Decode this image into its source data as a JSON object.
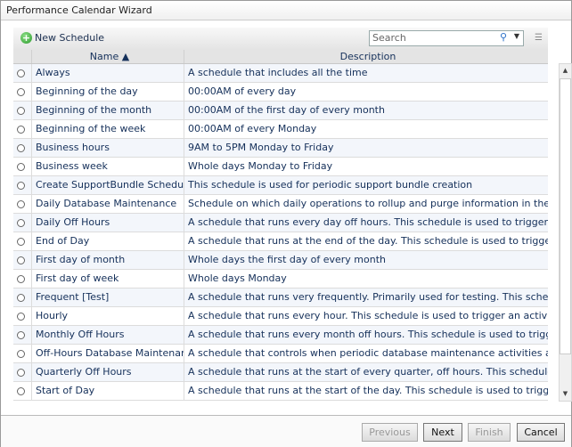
{
  "window": {
    "title": "Performance Calendar Wizard"
  },
  "toolbar": {
    "new_schedule": "New Schedule",
    "search_placeholder": "Search"
  },
  "columns": {
    "name": "Name ▲",
    "description": "Description"
  },
  "rows": [
    {
      "name": "Always",
      "description": "A schedule that includes all the time"
    },
    {
      "name": "Beginning of the day",
      "description": "00:00AM of every day"
    },
    {
      "name": "Beginning of the month",
      "description": "00:00AM of the first day of every month"
    },
    {
      "name": "Beginning of the week",
      "description": "00:00AM of every Monday"
    },
    {
      "name": "Business hours",
      "description": "9AM to 5PM Monday to Friday"
    },
    {
      "name": "Business week",
      "description": "Whole days Monday to Friday"
    },
    {
      "name": "Create SupportBundle Schedule",
      "description": "This schedule is used for periodic support bundle creation"
    },
    {
      "name": "Daily Database Maintenance",
      "description": "Schedule on which daily operations to rollup and purge information in the database a"
    },
    {
      "name": "Daily Off Hours",
      "description": "A schedule that runs every day off hours. This schedule is used to trigger an activit"
    },
    {
      "name": "End of Day",
      "description": "A schedule that runs at the end of the day. This schedule is used to trigger an activ"
    },
    {
      "name": "First day of month",
      "description": "Whole days the first day of every month"
    },
    {
      "name": "First day of week",
      "description": "Whole days Monday"
    },
    {
      "name": "Frequent [Test]",
      "description": "A schedule that runs very frequently. Primarily used for testing. This schedule is use"
    },
    {
      "name": "Hourly",
      "description": "A schedule that runs every hour. This schedule is used to trigger an activity. As a re"
    },
    {
      "name": "Monthly Off Hours",
      "description": "A schedule that runs every month off hours. This schedule is used to trigger an activi"
    },
    {
      "name": "Off-Hours Database Maintenance",
      "description": "A schedule that controls when periodic database maintenance activities are perform"
    },
    {
      "name": "Quarterly Off Hours",
      "description": "A schedule that runs at the start of every quarter, off hours. This schedule is used"
    },
    {
      "name": "Start of Day",
      "description": "A schedule that runs at the start of the day. This schedule is used to trigger an acti"
    }
  ],
  "footer": {
    "previous": "Previous",
    "next": "Next",
    "finish": "Finish",
    "cancel": "Cancel"
  }
}
